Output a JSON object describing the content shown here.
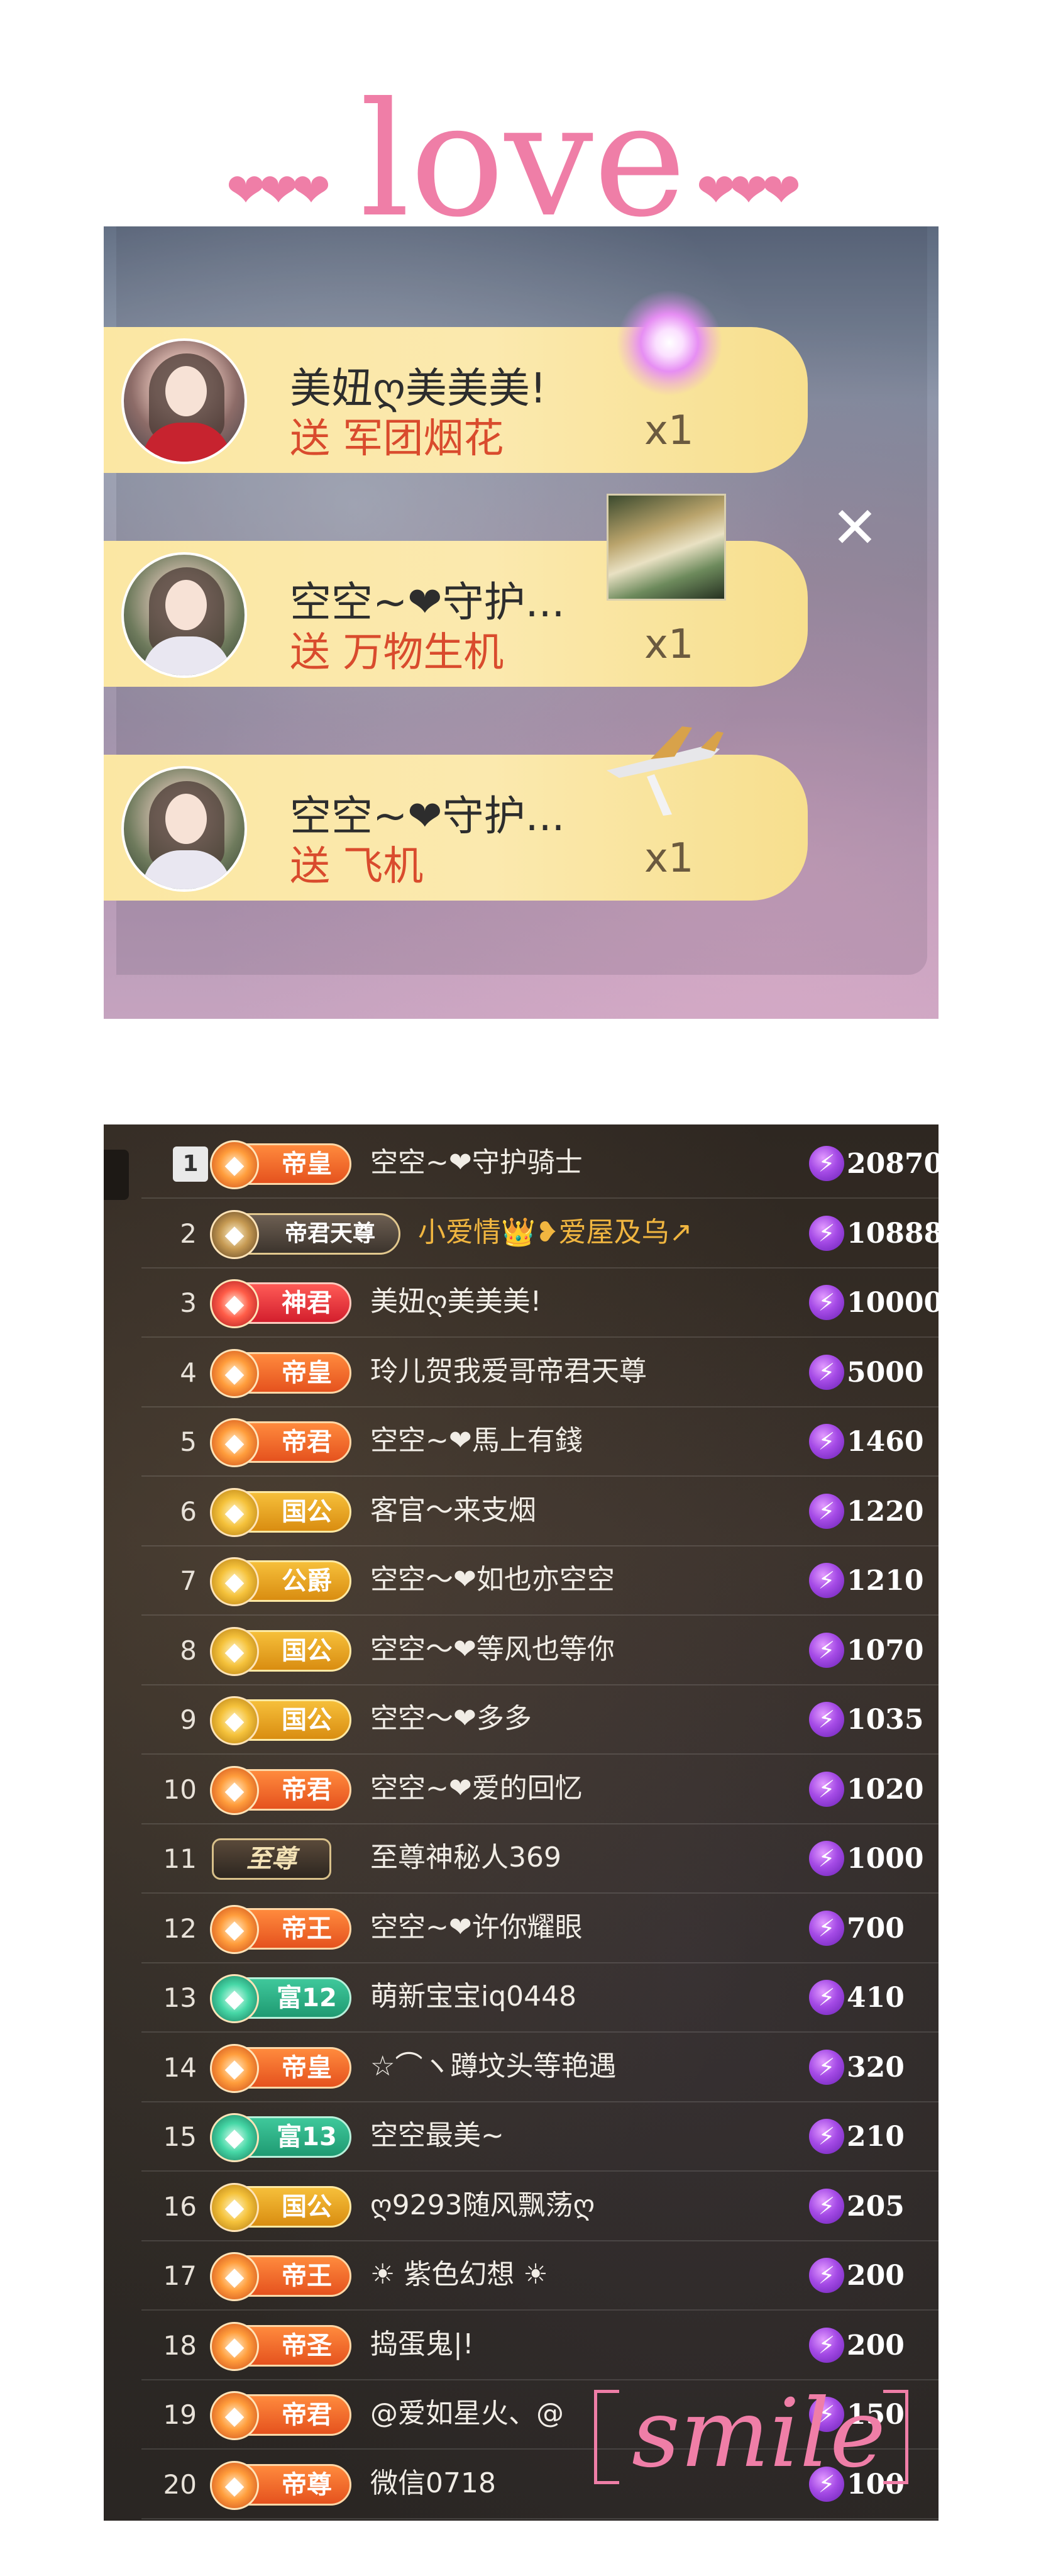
{
  "header": {
    "title": "love",
    "hearts_left": "❤❤❤",
    "hearts_right": "❤❤❤"
  },
  "gift_panel": {
    "close_label": "✕",
    "gifts": [
      {
        "sender": "美妞ღ美美美!",
        "action": "送 军团烟花",
        "count": "x1",
        "icon": "firework-icon"
      },
      {
        "sender": "空空~❤守护...",
        "action": "送 万物生机",
        "count": "x1",
        "icon": "scenery-icon"
      },
      {
        "sender": "空空~❤守护...",
        "action": "送 飞机",
        "count": "x1",
        "icon": "plane-icon"
      }
    ]
  },
  "rank_list": {
    "rows": [
      {
        "rank": "1",
        "badge": "帝皇",
        "badge_style": "orange",
        "name": "空空~❤守护骑士",
        "score": "20870"
      },
      {
        "rank": "2",
        "badge": "帝君天尊",
        "badge_style": "dijun-tianzun",
        "name": "小爱情👑❥爱屋及乌↗",
        "name_style": "gold-text",
        "score": "10888"
      },
      {
        "rank": "3",
        "badge": "神君",
        "badge_style": "red",
        "name": "美妞ღ美美美!",
        "score": "10000"
      },
      {
        "rank": "4",
        "badge": "帝皇",
        "badge_style": "orange",
        "name": "玲儿贺我爱哥帝君天尊",
        "score": "5000"
      },
      {
        "rank": "5",
        "badge": "帝君",
        "badge_style": "orange",
        "name": "空空~❤馬上有錢",
        "score": "1460"
      },
      {
        "rank": "6",
        "badge": "国公",
        "badge_style": "gold",
        "name": "客官～来支烟",
        "score": "1220"
      },
      {
        "rank": "7",
        "badge": "公爵",
        "badge_style": "gold",
        "name": "空空～❤如也亦空空",
        "score": "1210"
      },
      {
        "rank": "8",
        "badge": "国公",
        "badge_style": "gold",
        "name": "空空～❤等风也等你",
        "score": "1070"
      },
      {
        "rank": "9",
        "badge": "国公",
        "badge_style": "gold",
        "name": "空空～❤多多",
        "score": "1035"
      },
      {
        "rank": "10",
        "badge": "帝君",
        "badge_style": "orange",
        "name": "空空~❤爱的回忆",
        "score": "1020"
      },
      {
        "rank": "11",
        "badge": "至尊",
        "badge_style": "zhizun",
        "name": "至尊神秘人369",
        "score": "1000"
      },
      {
        "rank": "12",
        "badge": "帝王",
        "badge_style": "orange",
        "name": "空空~❤许你耀眼",
        "score": "700"
      },
      {
        "rank": "13",
        "badge": "富12",
        "badge_style": "green",
        "name": "萌新宝宝iq0448",
        "score": "410"
      },
      {
        "rank": "14",
        "badge": "帝皇",
        "badge_style": "orange",
        "name": "☆⌒ヽ蹲坟头等艳遇",
        "score": "320"
      },
      {
        "rank": "15",
        "badge": "富13",
        "badge_style": "green",
        "name": "空空最美~",
        "score": "210"
      },
      {
        "rank": "16",
        "badge": "国公",
        "badge_style": "gold",
        "name": "ღ9293随风飘荡ღ",
        "score": "205"
      },
      {
        "rank": "17",
        "badge": "帝王",
        "badge_style": "orange",
        "name": "☀ 紫色幻想 ☀",
        "score": "200"
      },
      {
        "rank": "18",
        "badge": "帝圣",
        "badge_style": "orange",
        "name": "捣蛋鬼|!",
        "score": "200"
      },
      {
        "rank": "19",
        "badge": "帝君",
        "badge_style": "orange",
        "name": "@爱如星火、@",
        "score": "150"
      },
      {
        "rank": "20",
        "badge": "帝尊",
        "badge_style": "orange",
        "name": "微信0718",
        "score": "100"
      }
    ]
  },
  "overlay": {
    "smile": "smile"
  },
  "colors": {
    "pink": "#ef7ea7",
    "bolt": "#a54be6",
    "gift_bar": "#fbe7a3"
  }
}
